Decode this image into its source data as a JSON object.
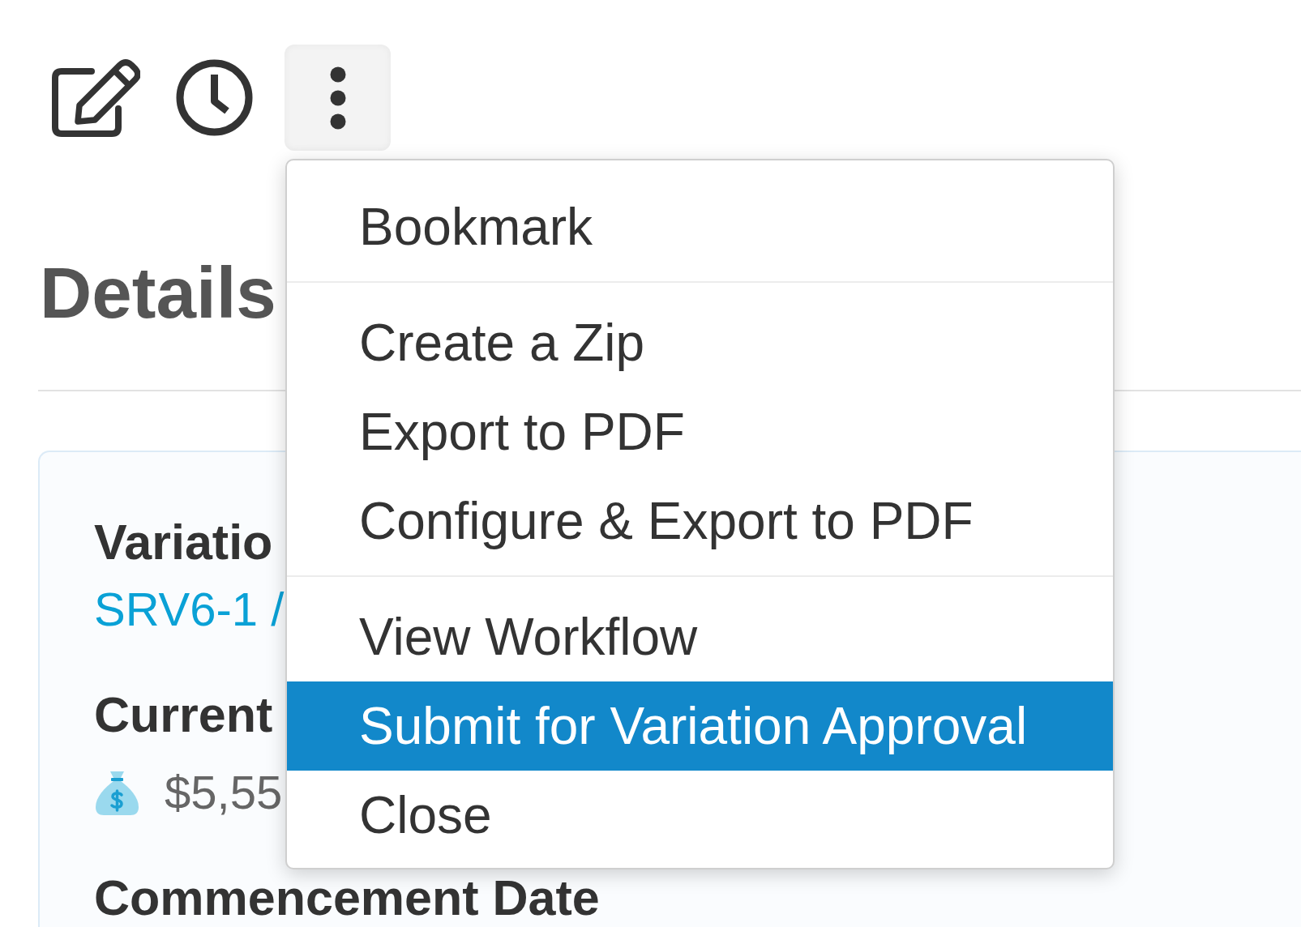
{
  "more_menu": {
    "expanded": true,
    "groups": [
      {
        "items": [
          {
            "label": "Bookmark",
            "selected": false
          }
        ]
      },
      {
        "items": [
          {
            "label": "Create a Zip",
            "selected": false
          },
          {
            "label": "Export to PDF",
            "selected": false
          },
          {
            "label": "Configure & Export to PDF",
            "selected": false
          }
        ]
      },
      {
        "items": [
          {
            "label": "View Workflow",
            "selected": false
          },
          {
            "label": "Submit for Variation Approval",
            "selected": true
          },
          {
            "label": "Close",
            "selected": false
          }
        ]
      }
    ]
  },
  "details": {
    "title": "Details",
    "fields": [
      {
        "label": "Variatio",
        "value": {
          "kind": "link",
          "text": "SRV6-1 /"
        }
      },
      {
        "label": "Current",
        "value": {
          "kind": "money",
          "text": "$5,55"
        }
      },
      {
        "label": "Commencement Date"
      }
    ]
  }
}
